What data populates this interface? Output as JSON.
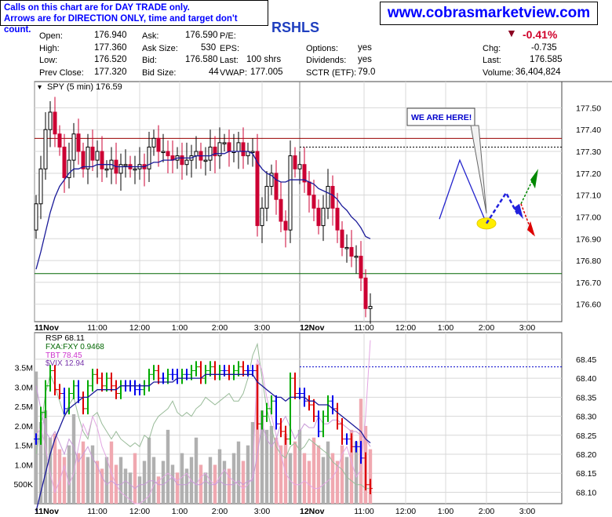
{
  "disclaimer": {
    "line1": "Calls on this chart are for DAY TRADE only.",
    "line2": "Arrows are for DIRECTION ONLY, time and target don't count."
  },
  "site": "www.cobrasmarketview.com",
  "symbol_title": "RSHLS",
  "quote": {
    "open_label": "Open:",
    "open": "176.940",
    "high_label": "High:",
    "high": "177.360",
    "low_label": "Low:",
    "low": "176.520",
    "prev_close_label": "Prev Close:",
    "prev_close": "177.320",
    "ask_label": "Ask:",
    "ask": "176.590",
    "ask_size_label": "Ask Size:",
    "ask_size": "530",
    "bid_label": "Bid:",
    "bid": "176.580",
    "bid_size_label": "Bid Size:",
    "bid_size": "44",
    "pe_label": "P/E:",
    "eps_label": "EPS:",
    "last_label": "Last:",
    "last_shares": "100 shrs",
    "vwap_label": "VWAP:",
    "vwap": "177.005",
    "options_label": "Options:",
    "options": "yes",
    "dividends_label": "Dividends:",
    "dividends": "yes",
    "sctr_label": "SCTR (ETF):",
    "sctr": "79.0",
    "change_pct": "-0.41%",
    "chg_label": "Chg:",
    "chg": "-0.735",
    "last2_label": "Last:",
    "last_price": "176.585",
    "volume_label": "Volume:",
    "volume": "36,404,824"
  },
  "colors": {
    "up": "#000000",
    "down": "#cc0033",
    "ma": "#1a1a99",
    "hline_red": "#990000",
    "hline_green": "#006600",
    "grid": "#d8d8d8"
  },
  "chart_data": [
    {
      "type": "candlestick",
      "legend": "SPY (5 min) 176.59",
      "x_ticks": [
        "11Nov",
        "11:00",
        "12:00",
        "1:00",
        "2:00",
        "3:00",
        "12Nov",
        "11:00",
        "12:00",
        "1:00",
        "2:00",
        "3:00"
      ],
      "y_ticks": [
        177.5,
        177.4,
        177.3,
        177.2,
        177.1,
        177.0,
        176.9,
        176.8,
        176.7,
        176.6
      ],
      "ylim": [
        176.52,
        177.62
      ],
      "horizontal_lines": [
        177.36,
        177.32,
        176.74
      ],
      "annotation": "WE ARE HERE!",
      "closes": [
        177.06,
        177.22,
        177.4,
        177.48,
        177.38,
        177.32,
        177.18,
        177.26,
        177.38,
        177.3,
        177.22,
        177.32,
        177.26,
        177.3,
        177.22,
        177.22,
        177.26,
        177.2,
        177.24,
        177.24,
        177.22,
        177.22,
        177.24,
        177.22,
        177.32,
        177.36,
        177.3,
        177.3,
        177.28,
        177.26,
        177.28,
        177.24,
        177.26,
        177.28,
        177.3,
        177.26,
        177.26,
        177.32,
        177.28,
        177.34,
        177.34,
        177.3,
        177.3,
        177.34,
        177.28,
        177.3,
        177.3,
        176.96,
        177.04,
        177.14,
        177.2,
        177.08,
        176.98,
        176.94,
        177.28,
        177.22,
        177.24,
        177.16,
        177.1,
        177.04,
        176.96,
        177.04,
        177.14,
        177.04,
        176.94,
        176.86,
        176.86,
        176.82,
        176.82,
        176.72,
        176.58,
        176.59
      ],
      "moving_average": [
        176.76,
        176.84,
        176.93,
        177.02,
        177.09,
        177.14,
        177.17,
        177.2,
        177.22,
        177.22,
        177.23,
        177.23,
        177.23,
        177.24,
        177.24,
        177.24,
        177.24,
        177.23,
        177.23,
        177.23,
        177.23,
        177.23,
        177.23,
        177.23,
        177.24,
        177.25,
        177.25,
        177.26,
        177.26,
        177.26,
        177.27,
        177.27,
        177.27,
        177.27,
        177.28,
        177.28,
        177.28,
        177.28,
        177.29,
        177.29,
        177.29,
        177.3,
        177.3,
        177.3,
        177.3,
        177.3,
        177.29,
        177.25,
        177.22,
        177.2,
        177.19,
        177.17,
        177.16,
        177.16,
        177.17,
        177.17,
        177.17,
        177.17,
        177.16,
        177.15,
        177.13,
        177.12,
        177.11,
        177.1,
        177.08,
        177.05,
        177.03,
        177.0,
        176.98,
        176.95,
        176.91,
        176.9
      ],
      "projection_blue": [
        [
          176.99,
          "11:40"
        ],
        [
          177.26,
          "1:20"
        ],
        [
          176.97,
          "2:00"
        ],
        [
          177.11,
          "2:25"
        ],
        [
          177.03,
          "2:40"
        ]
      ],
      "projection_green_to": 177.2,
      "projection_red_to": 176.92
    },
    {
      "type": "line+volume",
      "legend": [
        {
          "name": "RSP 68.11",
          "color": "#000000"
        },
        {
          "name": "FXA:FXY 0.9468",
          "color": "#006600"
        },
        {
          "name": "TBT 78.45",
          "color": "#cc33cc"
        },
        {
          "name": "$VIX 12.94",
          "color": "#7733aa"
        }
      ],
      "y_ticks_right": [
        68.45,
        68.4,
        68.35,
        68.3,
        68.25,
        68.2,
        68.15,
        68.1
      ],
      "y_ticks_left": [
        "3.5M",
        "3.0M",
        "2.5M",
        "2.0M",
        "1.5M",
        "1.0M",
        "500K"
      ],
      "ylim": [
        68.07,
        68.52
      ],
      "vol_max": 4400000,
      "rsp_closes": [
        68.24,
        68.31,
        68.38,
        68.42,
        68.37,
        68.36,
        68.32,
        68.36,
        68.38,
        68.35,
        68.32,
        68.38,
        68.41,
        68.4,
        68.38,
        68.4,
        68.38,
        68.36,
        68.38,
        68.38,
        68.38,
        68.37,
        68.37,
        68.38,
        68.41,
        68.42,
        68.4,
        68.4,
        68.41,
        68.41,
        68.4,
        68.41,
        68.41,
        68.42,
        68.43,
        68.4,
        68.42,
        68.43,
        68.41,
        68.42,
        68.42,
        68.41,
        68.42,
        68.43,
        68.42,
        68.42,
        68.42,
        68.28,
        68.3,
        68.32,
        68.34,
        68.28,
        68.26,
        68.24,
        68.4,
        68.36,
        68.36,
        68.34,
        68.33,
        68.3,
        68.26,
        68.3,
        68.34,
        68.32,
        68.28,
        68.24,
        68.24,
        68.22,
        68.22,
        68.19,
        68.12,
        68.11
      ],
      "rsp_ma": [
        68.05,
        68.1,
        68.15,
        68.2,
        68.24,
        68.27,
        68.3,
        68.32,
        68.33,
        68.34,
        68.35,
        68.35,
        68.36,
        68.37,
        68.37,
        68.37,
        68.37,
        68.37,
        68.38,
        68.38,
        68.38,
        68.38,
        68.38,
        68.38,
        68.38,
        68.39,
        68.39,
        68.39,
        68.39,
        68.39,
        68.4,
        68.4,
        68.4,
        68.4,
        68.4,
        68.4,
        68.41,
        68.41,
        68.41,
        68.41,
        68.41,
        68.41,
        68.41,
        68.41,
        68.41,
        68.41,
        68.41,
        68.39,
        68.38,
        68.37,
        68.36,
        68.35,
        68.35,
        68.34,
        68.35,
        68.35,
        68.35,
        68.35,
        68.34,
        68.34,
        68.33,
        68.33,
        68.33,
        68.32,
        68.31,
        68.3,
        68.29,
        68.28,
        68.27,
        68.26,
        68.24,
        68.23
      ],
      "volumes": [
        3400000,
        2100000,
        2400000,
        1700000,
        1800000,
        1400000,
        1200000,
        1500000,
        2300000,
        1300000,
        1600000,
        1200000,
        1500000,
        1100000,
        900000,
        1200000,
        1600000,
        1000000,
        1200000,
        900000,
        800000,
        1300000,
        700000,
        1100000,
        1700000,
        1200000,
        700000,
        1100000,
        1900000,
        1000000,
        800000,
        1300000,
        900000,
        1200000,
        1700000,
        1000000,
        800000,
        1200000,
        1000000,
        1400000,
        1100000,
        900000,
        1300000,
        1600000,
        1100000,
        1500000,
        2100000,
        3600000,
        2400000,
        1900000,
        2000000,
        1700000,
        1500000,
        1800000,
        1300000,
        1600000,
        1900000,
        1300000,
        1100000,
        1700000,
        1500000,
        1200000,
        1600000,
        1300000,
        1100000,
        1500000,
        1200000,
        1900000,
        1600000,
        2700000,
        2000000,
        1400000
      ],
      "fxafxy": [
        68.2,
        68.27,
        68.36,
        68.41,
        68.38,
        68.34,
        68.3,
        68.33,
        68.35,
        68.3,
        68.26,
        68.24,
        68.3,
        68.31,
        68.28,
        68.26,
        68.24,
        68.26,
        68.24,
        68.23,
        68.22,
        68.23,
        68.22,
        68.25,
        68.24,
        68.28,
        68.3,
        68.31,
        68.32,
        68.34,
        68.31,
        68.3,
        68.31,
        68.3,
        68.32,
        68.33,
        68.35,
        68.34,
        68.33,
        68.34,
        68.35,
        68.36,
        68.34,
        68.34,
        68.36,
        68.4,
        68.46,
        68.49,
        68.4,
        68.32,
        68.27,
        68.22,
        68.2,
        68.19,
        68.22,
        68.23,
        68.21,
        68.22,
        68.24,
        68.23,
        68.22,
        68.21,
        68.2,
        68.18,
        68.17,
        68.16,
        68.14,
        68.13,
        68.12,
        68.12,
        68.11,
        68.11
      ],
      "tbt": [
        68.25,
        68.27,
        68.22,
        68.15,
        68.1,
        68.13,
        68.17,
        68.12,
        68.15,
        68.22,
        68.28,
        68.25,
        68.3,
        68.27,
        68.22,
        68.19,
        68.15,
        68.12,
        68.1,
        68.09,
        68.08,
        68.07,
        68.07,
        68.08,
        68.09,
        68.12,
        68.13,
        68.14,
        68.15,
        68.14,
        68.13,
        68.14,
        68.15,
        68.13,
        68.12,
        68.14,
        68.15,
        68.13,
        68.12,
        68.14,
        68.16,
        68.14,
        68.13,
        68.12,
        68.11,
        68.12,
        68.14,
        68.45,
        68.42,
        68.35,
        68.3,
        68.25,
        68.2,
        68.15,
        68.13,
        68.12,
        68.12,
        68.13,
        68.12,
        68.11,
        68.11,
        68.12,
        68.13,
        68.14,
        68.16,
        68.2,
        68.22,
        68.18,
        68.14,
        68.16,
        68.3,
        68.5
      ],
      "vix": [
        68.38,
        68.32,
        68.26,
        68.24,
        68.26,
        68.23,
        68.2,
        68.24,
        68.22,
        68.18,
        68.2,
        68.22,
        68.19,
        68.17,
        68.14,
        68.12,
        68.13,
        68.12,
        68.12,
        68.13,
        68.12,
        68.11,
        68.12,
        68.12,
        68.13,
        68.13,
        68.12,
        68.12,
        68.13,
        68.14,
        68.12,
        68.12,
        68.12,
        68.13,
        68.12,
        68.12,
        68.13,
        68.12,
        68.12,
        68.13,
        68.12,
        68.12,
        68.12,
        68.13,
        68.12,
        68.13,
        68.13,
        68.2,
        68.28,
        68.24,
        68.22,
        68.24,
        68.28,
        68.3,
        68.27,
        68.24,
        68.26,
        68.28,
        68.27,
        68.27,
        68.3,
        68.28,
        68.28,
        68.29,
        68.29,
        68.28,
        68.27,
        68.26,
        68.26,
        68.25,
        68.24,
        68.22
      ]
    }
  ]
}
